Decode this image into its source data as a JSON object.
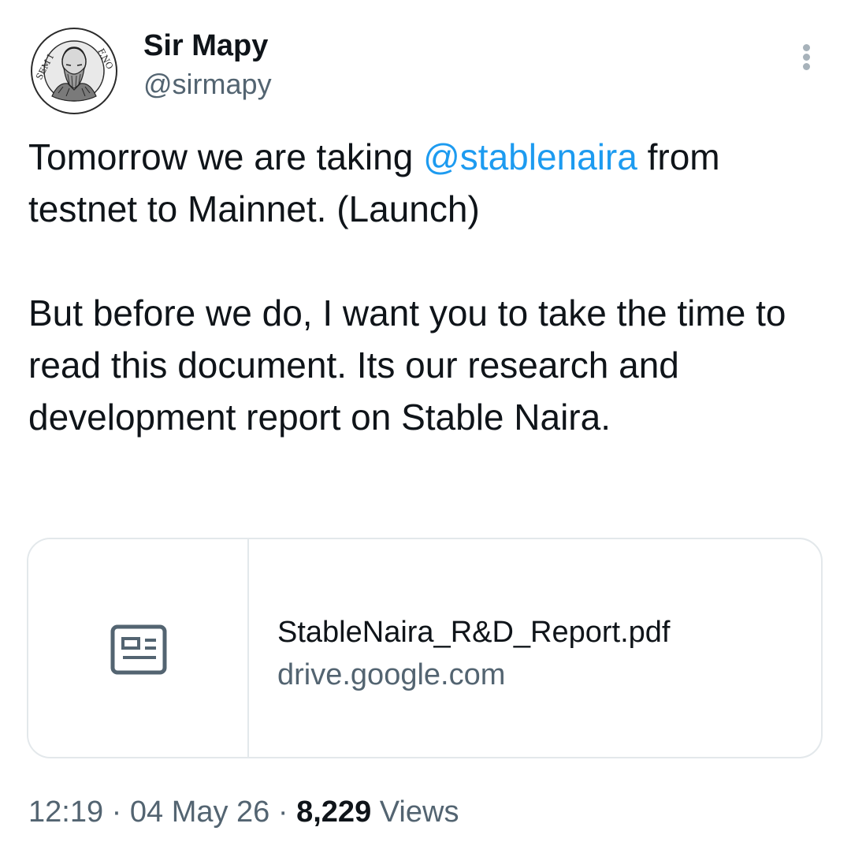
{
  "author": {
    "name": "Sir Mapy",
    "handle": "@sirmapy",
    "avatar": {
      "description_icon": "engraved-portrait-medallion",
      "left_inscription": "SEM I",
      "right_inscription": "F.NO"
    }
  },
  "more_icon": "vertical-ellipsis-icon",
  "tweet": {
    "text_part1": "Tomorrow we are taking ",
    "mention": "@stablenaira",
    "text_part2": " from testnet to Mainnet. (Launch)",
    "paragraph2": "But before we do, I want you to take the time to read this document. Its our research and development report on Stable Naira."
  },
  "link_card": {
    "icon": "document-icon",
    "title": "StableNaira_R&D_Report.pdf",
    "domain": "drive.google.com"
  },
  "meta": {
    "time": "12:19",
    "separator": "·",
    "date": "04 May 26",
    "views_count": "8,229",
    "views_label": "Views"
  },
  "colors": {
    "text": "#0f1419",
    "secondary": "#536471",
    "link": "#1d9bf0",
    "border": "#e3e8eb"
  }
}
